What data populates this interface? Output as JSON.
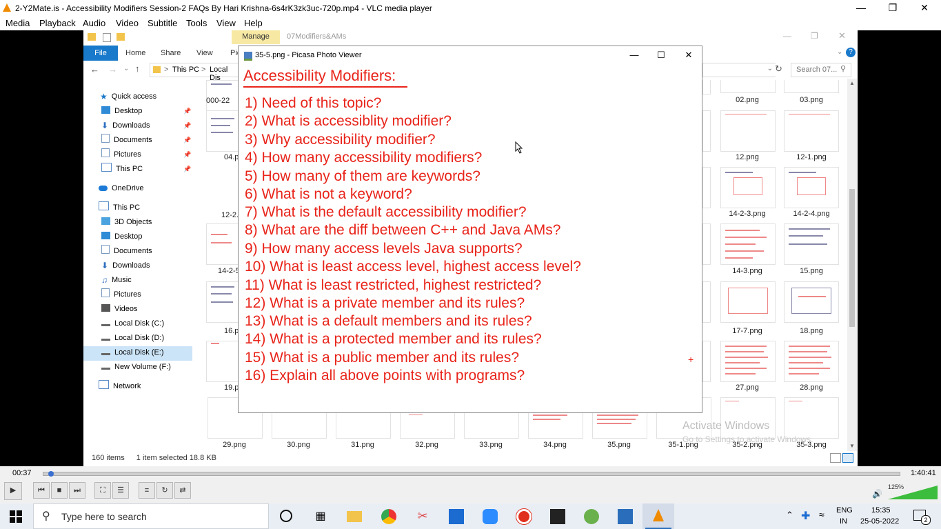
{
  "vlc": {
    "title": "2-Y2Mate.is - Accessibility Modifiers  Session-2  FAQs  By Hari Krishna-6s4rK3zk3uc-720p.mp4 - VLC media player",
    "menu": [
      "Media",
      "Playback",
      "Audio",
      "Video",
      "Subtitle",
      "Tools",
      "View",
      "Help"
    ],
    "time_elapsed": "00:37",
    "time_total": "1:40:41",
    "volume": "125%",
    "progress": 0.006
  },
  "explorer": {
    "manage_tab": "Manage",
    "folder_title": "07Modifiers&AMs",
    "tabs": [
      "File",
      "Home",
      "Share",
      "View",
      "Pic"
    ],
    "breadcrumb": [
      ">",
      "This PC",
      ">",
      "Local Dis"
    ],
    "search_placeholder": "Search 07...",
    "nav": [
      {
        "label": "Quick access",
        "pinned": false
      },
      {
        "label": "Desktop",
        "pinned": true
      },
      {
        "label": "Downloads",
        "pinned": true
      },
      {
        "label": "Documents",
        "pinned": true
      },
      {
        "label": "Pictures",
        "pinned": true
      },
      {
        "label": "This PC",
        "pinned": true
      },
      {
        "label": "OneDrive",
        "pinned": false
      },
      {
        "label": "This PC",
        "pinned": false
      },
      {
        "label": "3D Objects",
        "pinned": false
      },
      {
        "label": "Desktop",
        "pinned": false
      },
      {
        "label": "Documents",
        "pinned": false
      },
      {
        "label": "Downloads",
        "pinned": false
      },
      {
        "label": "Music",
        "pinned": false
      },
      {
        "label": "Pictures",
        "pinned": false
      },
      {
        "label": "Videos",
        "pinned": false
      },
      {
        "label": "Local Disk (C:)",
        "pinned": false
      },
      {
        "label": "Local Disk (D:)",
        "pinned": false
      },
      {
        "label": "Local Disk (E:)",
        "pinned": false
      },
      {
        "label": "New Volume (F:)",
        "pinned": false
      },
      {
        "label": "Network",
        "pinned": false
      }
    ],
    "status_items": "160 items",
    "status_selected": "1 item selected  18.8 KB",
    "left_labels": [
      "000-22",
      "04.p",
      "12-2.",
      "14-2-5",
      "16.p",
      "19.p"
    ],
    "right_files": [
      "02.png",
      "03.png",
      "12.png",
      "12-1.png",
      "14-2-3.png",
      "14-2-4.png",
      "14-3.png",
      "15.png",
      "17-7.png",
      "18.png",
      "27.png",
      "28.png"
    ],
    "bottom_files": [
      "29.png",
      "30.png",
      "31.png",
      "32.png",
      "33.png",
      "34.png",
      "35.png",
      "35-1.png",
      "35-2.png",
      "35-3.png"
    ],
    "watermark_line1": "Activate Windows",
    "watermark_line2": "Go to Settings to activate Windows."
  },
  "picasa": {
    "title": "35-5.png - Picasa Photo Viewer",
    "slide_title": "Accessibility Modifiers:",
    "questions": [
      "1) Need of this topic?",
      "2) What is accessiblity modifier?",
      "3) Why accessibility modifier?",
      "4) How many accessibility modifiers?",
      "5) How many of them are keywords?",
      "6) What is not a keyword?",
      "7) What is the default accessibility modifier?",
      "8) What are the diff between C++ and Java AMs?",
      "9) How many access levels Java supports?",
      "10) What is least access level, highest access level?",
      "11) What is least restricted, highest restricted?",
      "12) What is a private member and its rules?",
      "13) What is a default members and its rules?",
      "14) What is a protected member and its rules?",
      "15) What is a public member and its rules?",
      "16) Explain all above points with programs?"
    ],
    "plus": "+"
  },
  "taskbar": {
    "search_placeholder": "Type here to search",
    "lang_top": "ENG",
    "lang_bottom": "IN",
    "time": "15:35",
    "date": "25-05-2022",
    "notifications": "2"
  }
}
